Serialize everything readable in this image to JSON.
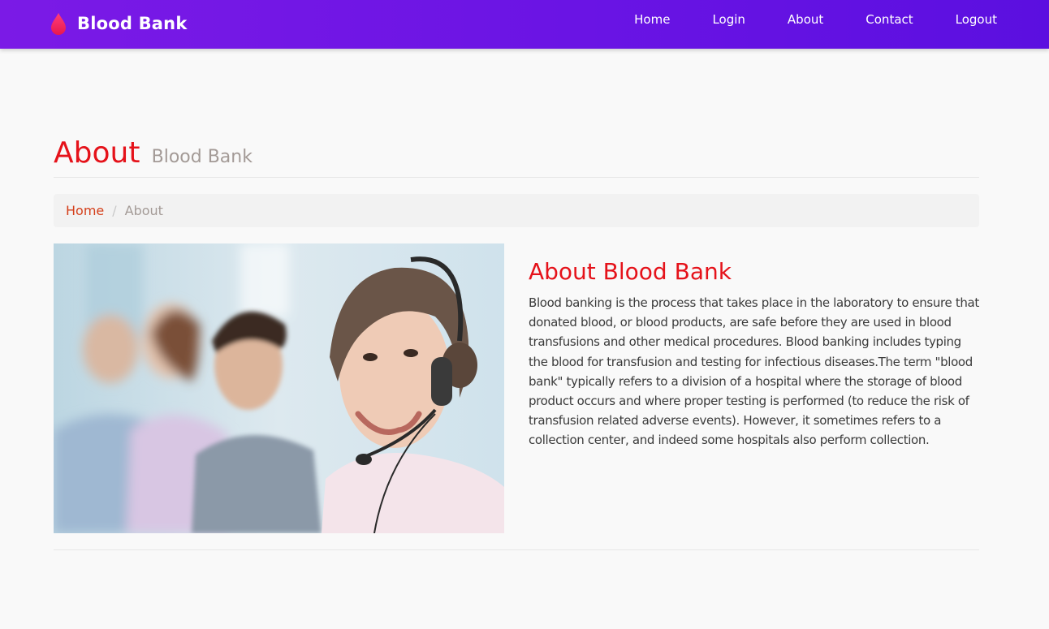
{
  "navbar": {
    "brand": "Blood Bank",
    "brand_icon": "blood-drop-icon",
    "links": [
      "Home",
      "Login",
      "About",
      "Contact",
      "Logout"
    ]
  },
  "page_header": {
    "title": "About",
    "subtitle": "Blood Bank"
  },
  "breadcrumb": {
    "home": "Home",
    "separator": "/",
    "current": "About"
  },
  "about": {
    "heading": "About Blood Bank",
    "body": "Blood banking is the process that takes place in the laboratory to ensure that donated blood, or blood products, are safe before they are used in blood transfusions and other medical procedures. Blood banking includes typing the blood for transfusion and testing for infectious diseases.The term \"blood bank\" typically refers to a division of a hospital where the storage of blood product occurs and where proper testing is performed (to reduce the risk of transfusion related adverse events). However, it sometimes refers to a collection center, and indeed some hospitals also perform collection."
  },
  "colors": {
    "navbar_gradient_start": "#7b1ae6",
    "navbar_gradient_end": "#5b0fe0",
    "accent_red": "#e5121a",
    "breadcrumb_link": "#d43f1a",
    "muted_text": "#a39a96",
    "page_background": "#f9f9f9"
  }
}
